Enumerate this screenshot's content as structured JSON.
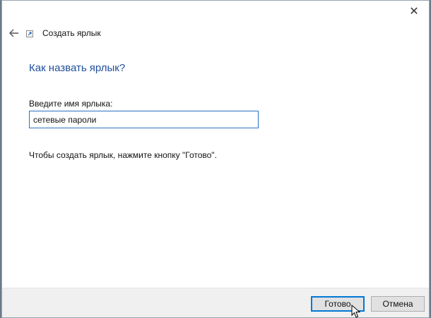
{
  "window": {
    "close_icon": "close-icon",
    "back_icon": "arrow-left-icon",
    "app_icon": "shortcut-icon",
    "title": "Создать ярлык"
  },
  "main": {
    "heading": "Как назвать ярлык?",
    "field_label": "Введите имя ярлыка:",
    "name_value": "сетевые пароли",
    "hint": "Чтобы создать ярлык, нажмите кнопку \"Готово\"."
  },
  "footer": {
    "finish_label": "Готово",
    "cancel_label": "Отмена"
  },
  "colors": {
    "heading": "#1f4e9c",
    "focus": "#0078d7"
  }
}
